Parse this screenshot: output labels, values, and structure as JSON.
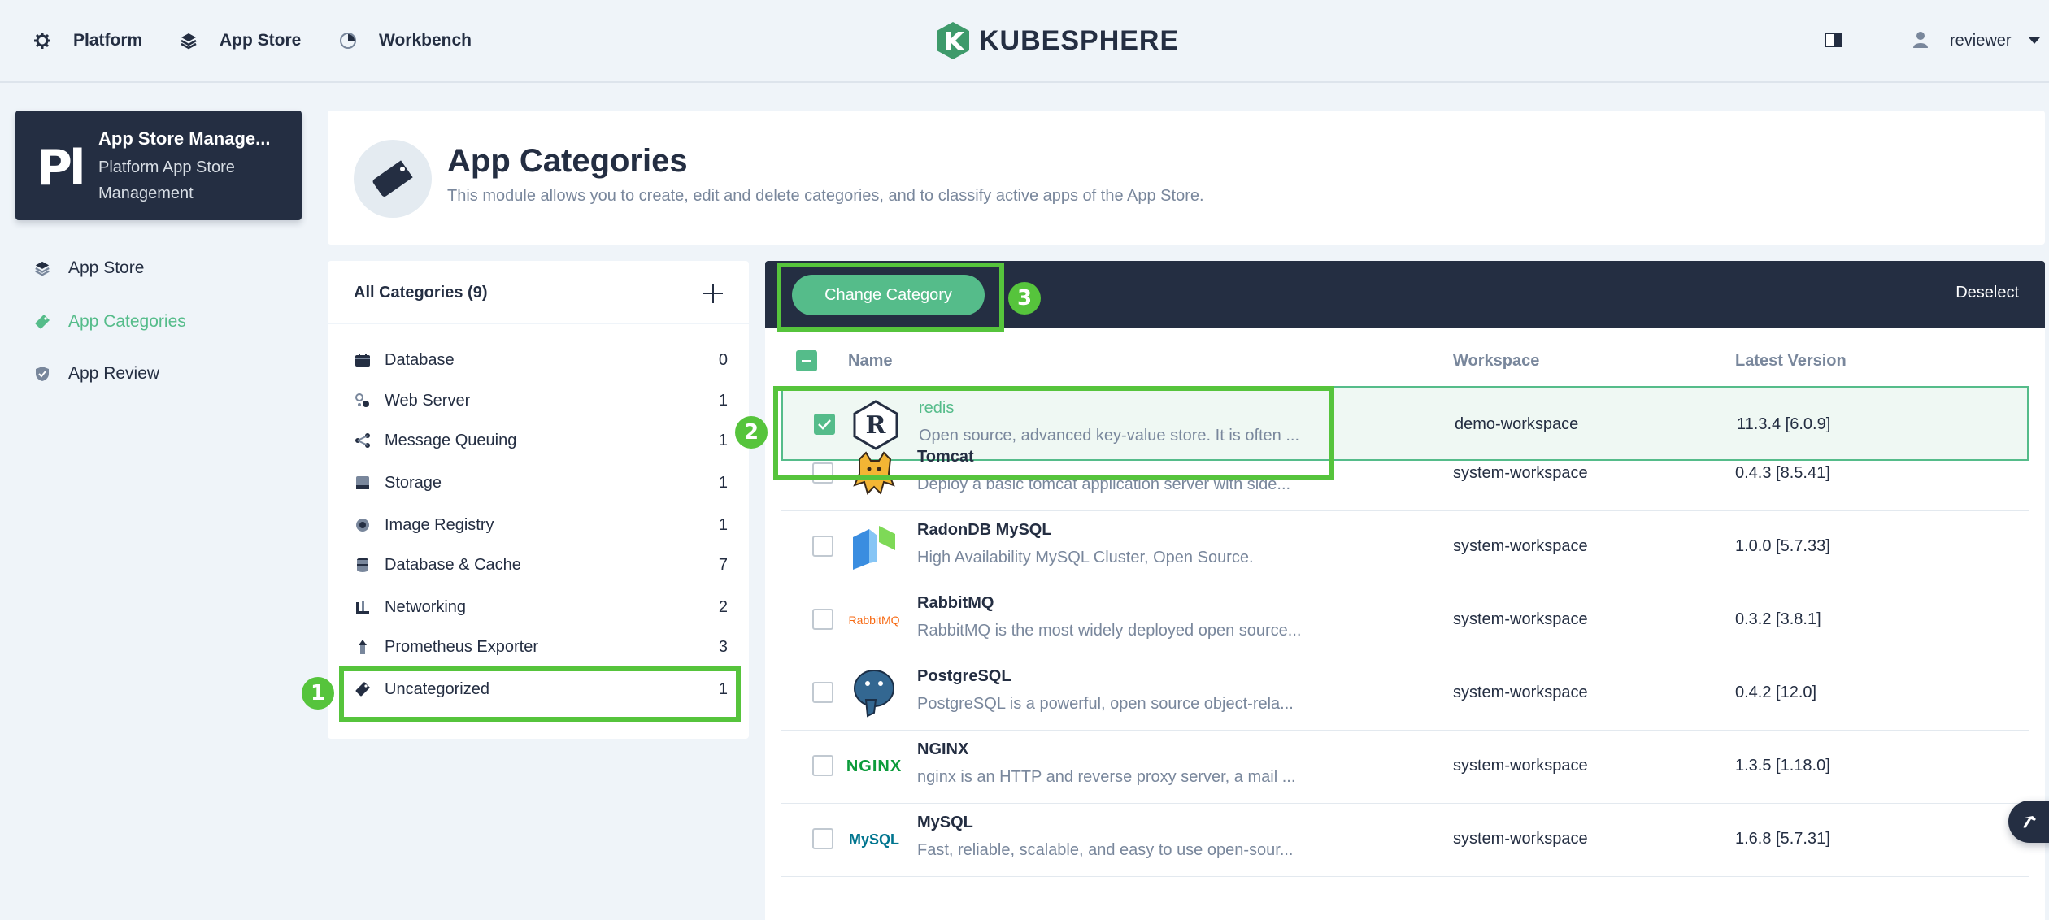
{
  "topnav": {
    "items": [
      {
        "label": "Platform",
        "icon": "gear-icon"
      },
      {
        "label": "App Store",
        "icon": "layers-icon"
      },
      {
        "label": "Workbench",
        "icon": "dashboard-icon"
      }
    ],
    "logo_text": "KUBESPHERE",
    "user": "reviewer",
    "colors": {
      "brand": "#3e9a6b",
      "accent": "#55bc8a",
      "dark": "#242e42"
    }
  },
  "workspace": {
    "logo": "Pl",
    "title": "App Store Manage...",
    "subtitle": "Platform App Store Management"
  },
  "sidebar": {
    "items": [
      {
        "label": "App Store",
        "icon": "layers-icon",
        "active": false
      },
      {
        "label": "App Categories",
        "icon": "tag-icon",
        "active": true
      },
      {
        "label": "App Review",
        "icon": "shield-icon",
        "active": false
      }
    ]
  },
  "banner": {
    "title": "App Categories",
    "description": "This module allows you to create, edit and delete categories, and to classify active apps of the App Store."
  },
  "categories": {
    "header": "All Categories (9)",
    "items": [
      {
        "name": "Database",
        "count": "0",
        "icon": "database-icon"
      },
      {
        "name": "Web Server",
        "count": "1",
        "icon": "web-server-icon"
      },
      {
        "name": "Message Queuing",
        "count": "1",
        "icon": "message-queue-icon"
      },
      {
        "name": "Storage",
        "count": "1",
        "icon": "storage-icon"
      },
      {
        "name": "Image Registry",
        "count": "1",
        "icon": "image-registry-icon"
      },
      {
        "name": "Database & Cache",
        "count": "7",
        "icon": "database-cache-icon"
      },
      {
        "name": "Networking",
        "count": "2",
        "icon": "networking-icon"
      },
      {
        "name": "Prometheus Exporter",
        "count": "3",
        "icon": "exporter-icon"
      },
      {
        "name": "Uncategorized",
        "count": "1",
        "icon": "tag-icon"
      }
    ]
  },
  "toolbar": {
    "change_label": "Change Category",
    "deselect_label": "Deselect"
  },
  "table": {
    "columns": [
      "Name",
      "Workspace",
      "Latest Version"
    ],
    "rows": [
      {
        "name": "redis",
        "desc": "Open source, advanced key-value store. It is often ...",
        "workspace": "demo-workspace",
        "version": "11.3.4 [6.0.9]",
        "icon": "redis-icon",
        "checked": true
      },
      {
        "name": "Tomcat",
        "desc": "Deploy a basic tomcat application server with side...",
        "workspace": "system-workspace",
        "version": "0.4.3 [8.5.41]",
        "icon": "tomcat-icon",
        "checked": false
      },
      {
        "name": "RadonDB MySQL",
        "desc": "High Availability MySQL Cluster, Open Source.",
        "workspace": "system-workspace",
        "version": "1.0.0 [5.7.33]",
        "icon": "radondb-icon",
        "checked": false
      },
      {
        "name": "RabbitMQ",
        "desc": "RabbitMQ is the most widely deployed open source...",
        "workspace": "system-workspace",
        "version": "0.3.2 [3.8.1]",
        "icon": "rabbitmq-icon",
        "checked": false
      },
      {
        "name": "PostgreSQL",
        "desc": "PostgreSQL is a powerful, open source object-rela...",
        "workspace": "system-workspace",
        "version": "0.4.2 [12.0]",
        "icon": "postgresql-icon",
        "checked": false
      },
      {
        "name": "NGINX",
        "desc": "nginx is an HTTP and reverse proxy server, a mail ...",
        "workspace": "system-workspace",
        "version": "1.3.5 [1.18.0]",
        "icon": "nginx-icon",
        "checked": false
      },
      {
        "name": "MySQL",
        "desc": "Fast, reliable, scalable, and easy to use open-sour...",
        "workspace": "system-workspace",
        "version": "1.6.8 [5.7.31]",
        "icon": "mysql-icon",
        "checked": false
      }
    ]
  },
  "icon_text": {
    "rabbitmq": "RabbitMQ",
    "nginx": "NGINX",
    "mysql": "MySQL"
  },
  "annotations": {
    "labels": [
      "1",
      "2",
      "3"
    ],
    "color": "#56c43c"
  }
}
